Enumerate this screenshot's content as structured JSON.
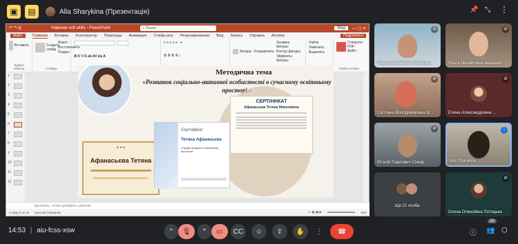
{
  "meet": {
    "presenter_label": "Alla Sharykina (Презентація)",
    "time": "14:53",
    "meeting_code": "aiu-fcss-xsw",
    "participant_badge": "29"
  },
  "powerpoint": {
    "window_title": "Навички soft skills  -  PowerPoint",
    "search_placeholder": "Пошук",
    "signin": "Вхід",
    "tabs": [
      "Файл",
      "Главная",
      "Вставка",
      "Конструктор",
      "Переходы",
      "Анимация",
      "Слайд-шоу",
      "Рецензирование",
      "Вид",
      "Запись",
      "Справка",
      "Acrobat"
    ],
    "share": "Поділитися",
    "ribbon": {
      "clipboard": "Буфер обмена",
      "paste": "Вставить",
      "slides": "Слайды",
      "new_slide": "Создать слайд",
      "layout": "Макет",
      "reset": "Восстановить",
      "section": "Раздел",
      "font": "Шрифт",
      "paragraph": "Абзац",
      "drawing": "Рисование",
      "shapes": "Фигуры",
      "arrange": "Упорядочить",
      "styles": "Экспресс-стили",
      "fill": "Заливка фигуры",
      "outline": "Контур фигуры",
      "effects": "Эффекты фигуры",
      "find": "Найти",
      "replace": "Заменить",
      "select": "Выделить",
      "editing": "Редактирование",
      "create_pdf": "Створити PDF-файл",
      "acrobat": "Adobe Acrobat"
    },
    "slide": {
      "title": "Методична тема",
      "subtitle": "«Розвиток соціально-активної особистості в сучасному освітньому просторі.»",
      "cert1_name": "Афанасьєва Тетяна",
      "cert2_heading": "Сертифікат",
      "cert2_name": "Тетяна Афанасьєва",
      "cert2_course": "«Право людини в освітньому просторі»",
      "cert3_heading": "СЕРТИФІКАТ",
      "cert3_name": "Афанасьєва Тетяна Миколаївна"
    },
    "notes_placeholder": "Щелкните, чтобы добавить заметки",
    "status_slide": "Слайд 6 из 15",
    "status_lang": "русский (Украина)",
    "zoom": "48%"
  },
  "participants": [
    {
      "name": "Людмила Іванівна Мелешко"
    },
    {
      "name": "Ольга Михайлівна Іващенко"
    },
    {
      "name": "Світлана Володимирівна Ш..."
    },
    {
      "name": "Елена Александровна ..."
    },
    {
      "name": "Віталій Павлович Січкар"
    },
    {
      "name": "Alla Sharykina"
    },
    {
      "name": "Ще 21 особа"
    },
    {
      "name": "Олена Олексіївна Потоцька"
    }
  ]
}
